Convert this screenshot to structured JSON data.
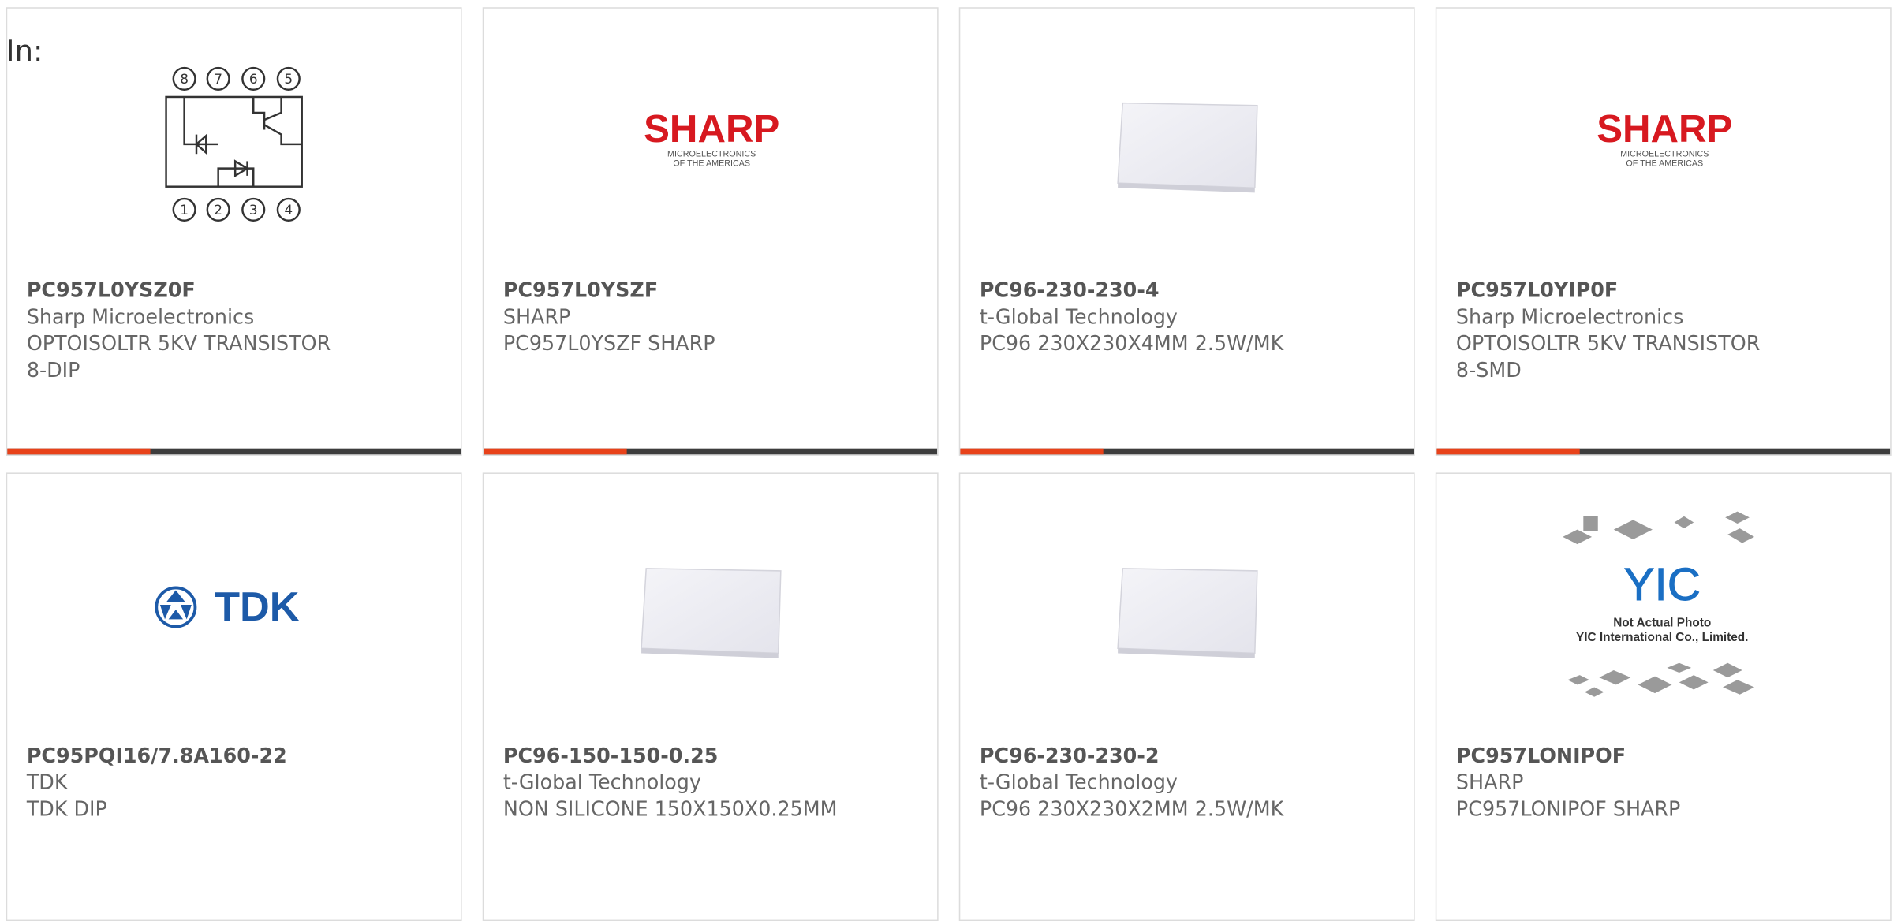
{
  "header": {
    "label": "In:"
  },
  "colors": {
    "accent": "#e8421a",
    "bar": "#3d3d3d",
    "border": "#dcdcdc",
    "text": "#666666"
  },
  "products": [
    {
      "part": "PC957L0YSZ0F",
      "maker": "Sharp Microelectronics",
      "desc1": "OPTOISOLTR 5KV TRANSISTOR",
      "desc2": "8-DIP",
      "image": "optocoupler-schematic-icon",
      "logo_text": ""
    },
    {
      "part": "PC957L0YSZF",
      "maker": "SHARP",
      "desc1": "PC957L0YSZF SHARP",
      "desc2": "",
      "image": "sharp-logo",
      "logo_text": "SHARP",
      "logo_sub": "MICROELECTRONICS OF THE AMERICAS"
    },
    {
      "part": "PC96-230-230-4",
      "maker": "t-Global Technology",
      "desc1": "PC96 230X230X4MM 2.5W/MK",
      "desc2": "",
      "image": "thermal-pad-icon",
      "logo_text": ""
    },
    {
      "part": "PC957L0YIP0F",
      "maker": "Sharp Microelectronics",
      "desc1": "OPTOISOLTR 5KV TRANSISTOR",
      "desc2": "8-SMD",
      "image": "sharp-logo",
      "logo_text": "SHARP",
      "logo_sub": "MICROELECTRONICS OF THE AMERICAS"
    },
    {
      "part": "PC95PQI16/7.8A160-22",
      "maker": "TDK",
      "desc1": "TDK DIP",
      "desc2": "",
      "image": "tdk-logo",
      "logo_text": "TDK"
    },
    {
      "part": "PC96-150-150-0.25",
      "maker": "t-Global Technology",
      "desc1": "NON SILICONE 150X150X0.25MM",
      "desc2": "",
      "image": "thermal-pad-icon",
      "logo_text": ""
    },
    {
      "part": "PC96-230-230-2",
      "maker": "t-Global Technology",
      "desc1": "PC96 230X230X2MM 2.5W/MK",
      "desc2": "",
      "image": "thermal-pad-icon",
      "logo_text": ""
    },
    {
      "part": "PC957LONIPOF",
      "maker": "SHARP",
      "desc1": "PC957LONIPOF SHARP",
      "desc2": "",
      "image": "not-actual-photo-placeholder",
      "logo_text": "YIC",
      "logo_sub1": "Not Actual Photo",
      "logo_sub2": "YIC International Co., Limited."
    }
  ]
}
